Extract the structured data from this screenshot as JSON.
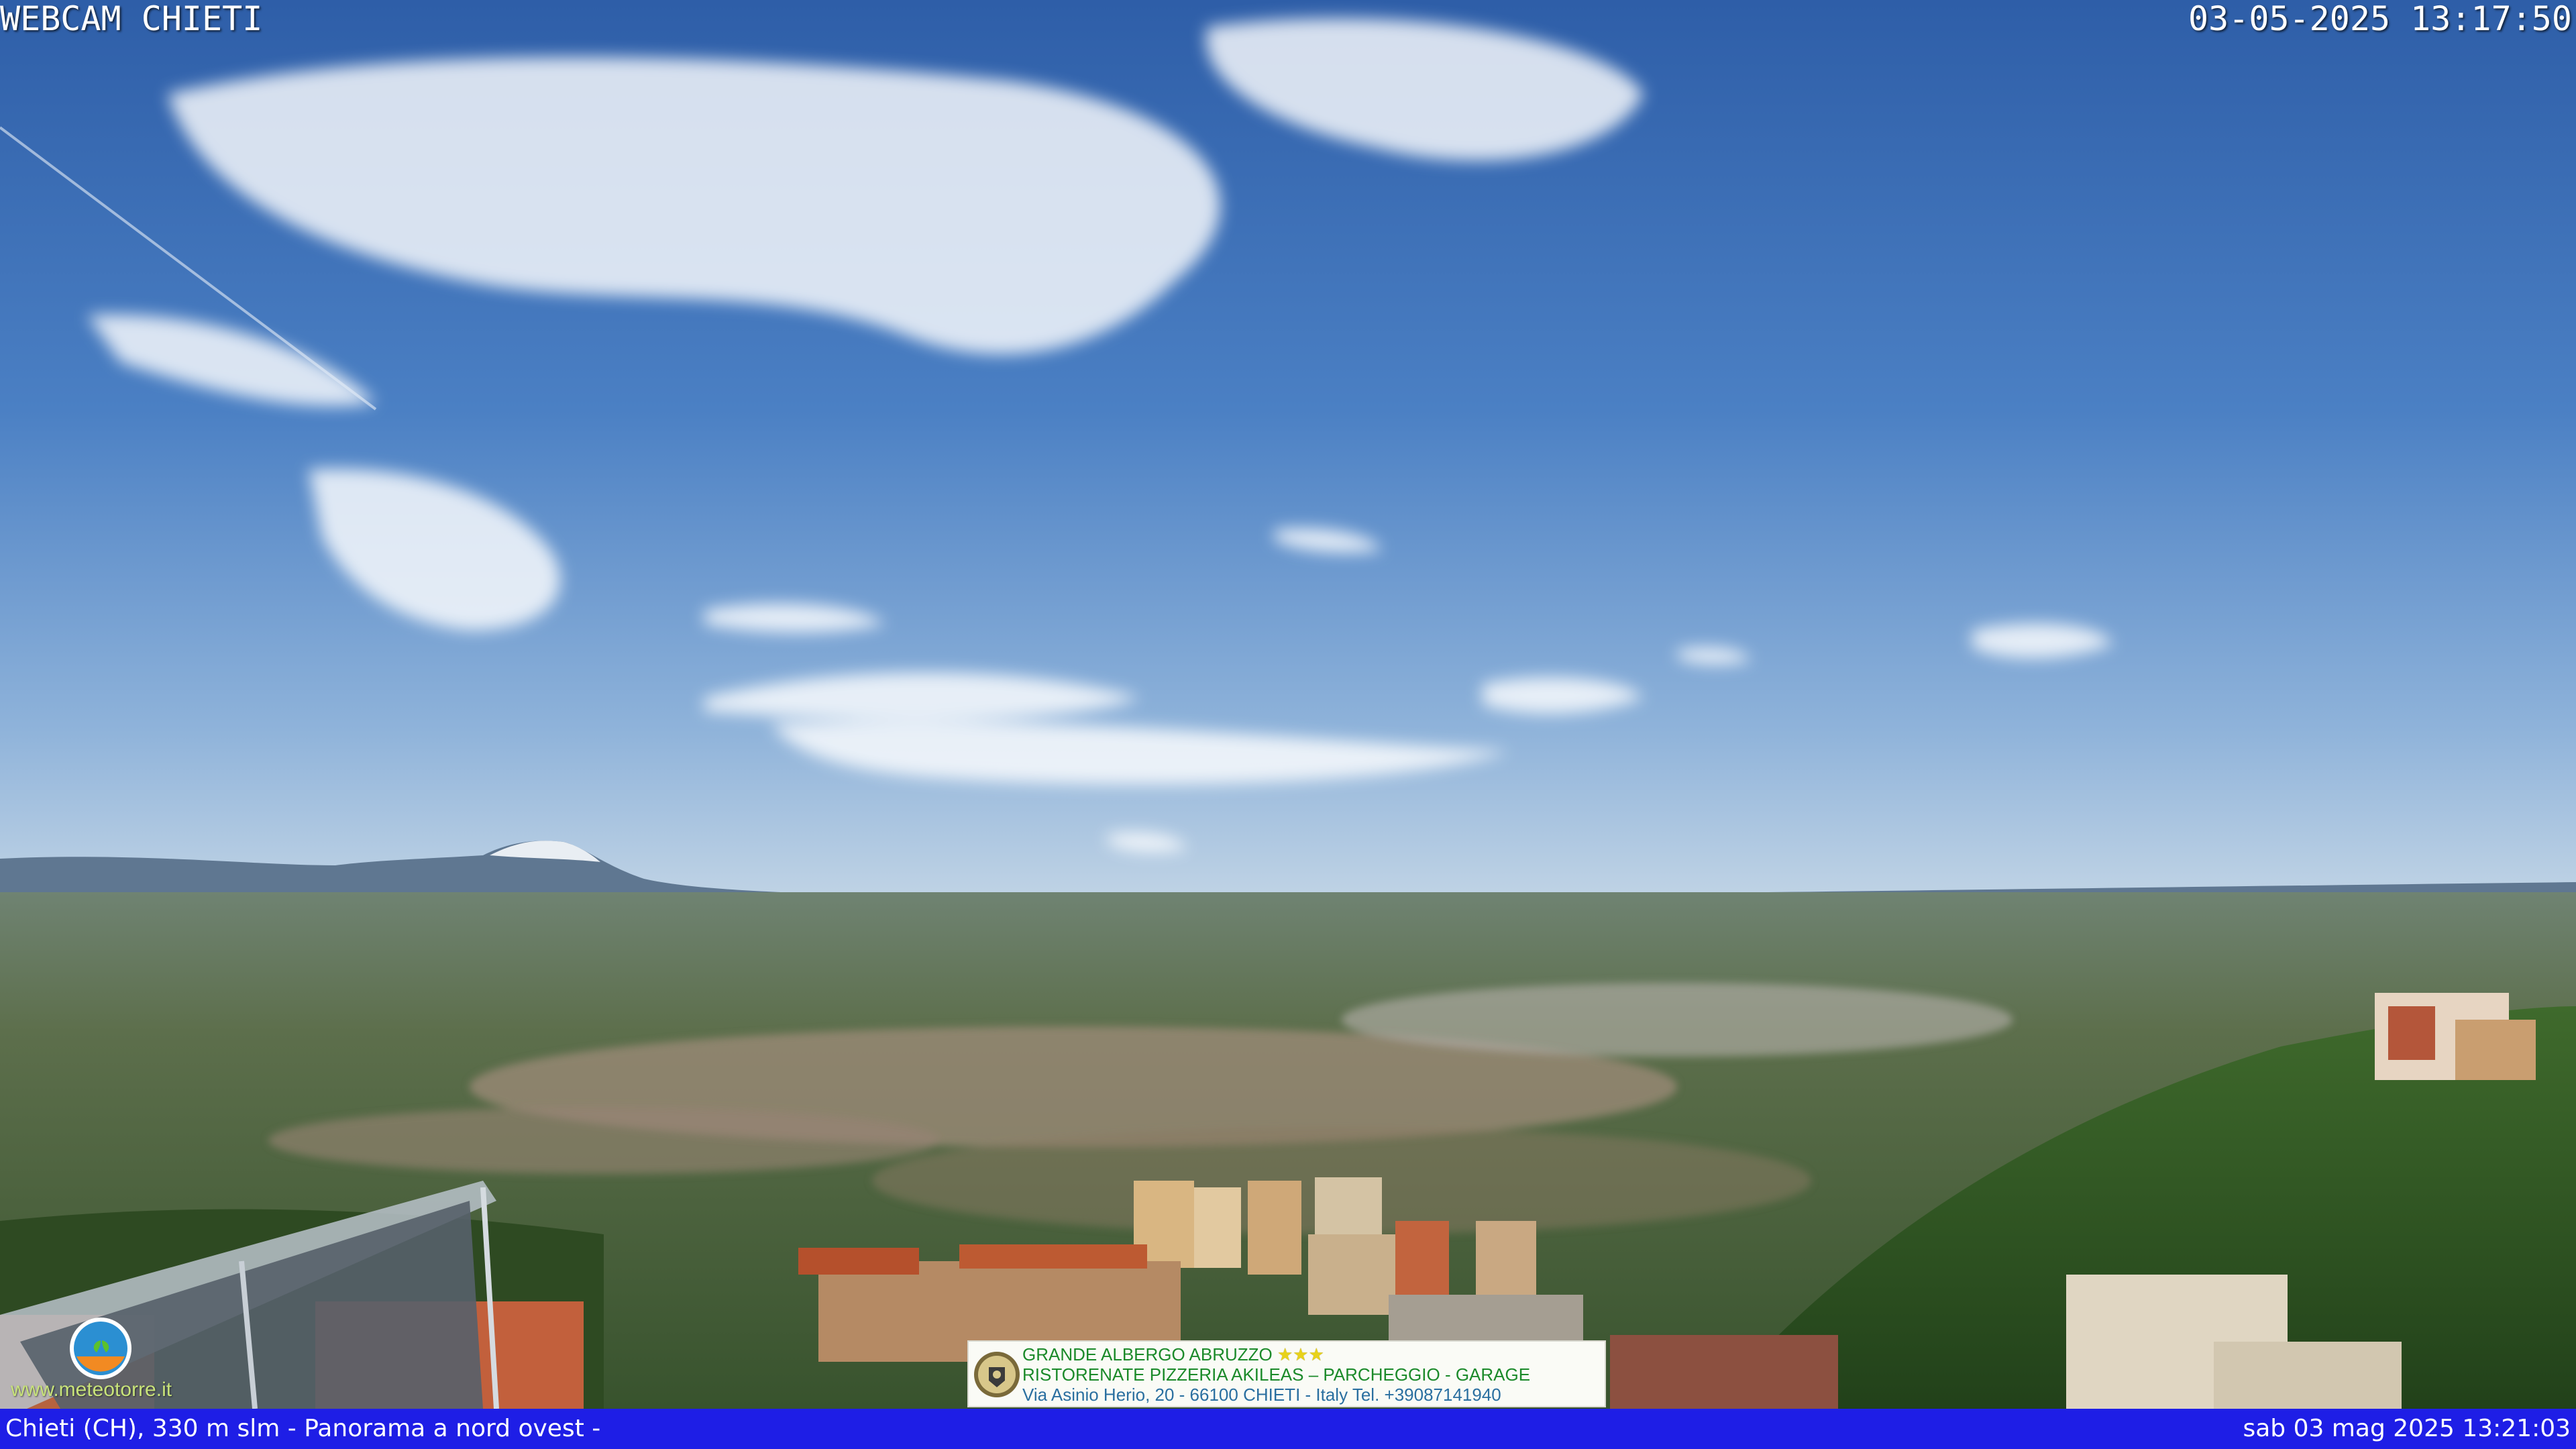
{
  "overlay": {
    "title": "WEBCAM CHIETI",
    "timestamp": "03-05-2025 13:17:50"
  },
  "footer": {
    "location": "Chieti (CH), 330 m slm - Panorama a nord ovest -",
    "datetime": "sab 03 mag 2025 13:21:03"
  },
  "ad": {
    "line1": "GRANDE ALBERGO ABRUZZO",
    "stars": "★★★",
    "line2": "RISTORENATE PIZZERIA AKILEAS – PARCHEGGIO - GARAGE",
    "line3": "Via Asinio Herio, 20 - 66100 CHIETI - Italy Tel. +39087141940"
  },
  "watermark": {
    "url": "www.meteotorre.it"
  },
  "colors": {
    "sky_top": "#2e5ea8",
    "sky_horizon": "#b9d0e6",
    "bottom_bar": "#1e1ee6"
  }
}
